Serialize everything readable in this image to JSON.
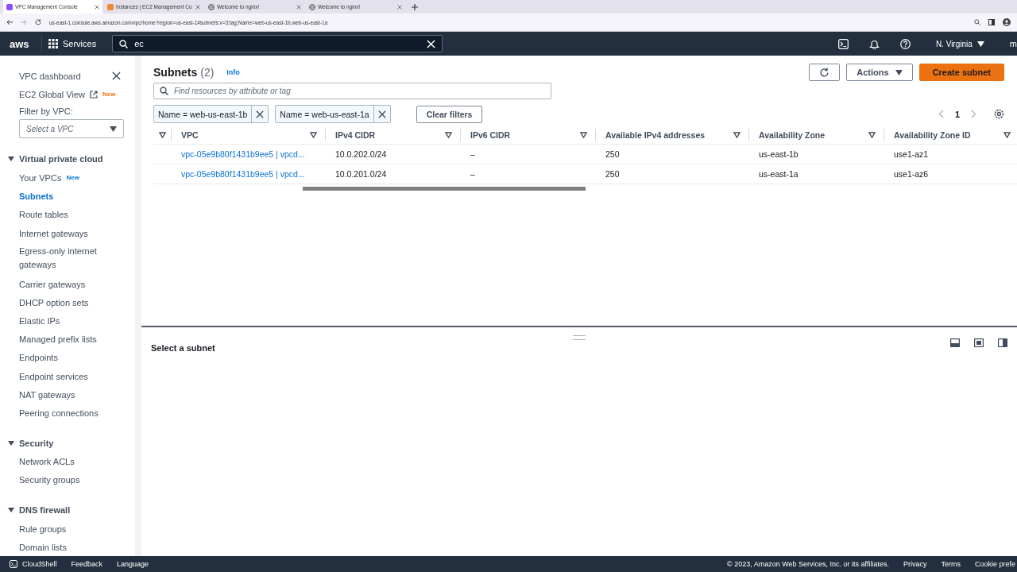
{
  "browser": {
    "tabs": [
      {
        "title": "VPC Management Console",
        "selected": true,
        "kind": "vpc"
      },
      {
        "title": "Instances | EC2 Management Co",
        "selected": false,
        "kind": "ec2"
      },
      {
        "title": "Welcome to nginx!",
        "selected": false,
        "kind": "globe"
      },
      {
        "title": "Welcome to nginx!",
        "selected": false,
        "kind": "globe"
      }
    ],
    "url": "us-east-1.console.aws.amazon.com/vpc/home?region=us-east-1#subnets:v=3;tag:Name=web-us-east-1b,web-us-east-1a"
  },
  "topnav": {
    "logo": "aws",
    "services": "Services",
    "search": "ec",
    "region": "N. Virginia",
    "account": "m"
  },
  "sidebar": {
    "top_items": [
      {
        "label": "VPC dashboard"
      },
      {
        "label": "EC2 Global View",
        "external": true,
        "badge": "New"
      }
    ],
    "filter_label": "Filter by VPC:",
    "filter_placeholder": "Select a VPC",
    "sections": [
      {
        "title": "Virtual private cloud",
        "expanded": true,
        "items": [
          {
            "label": "Your VPCs",
            "badge": "New",
            "selected": false
          },
          {
            "label": "Subnets",
            "selected": true
          },
          {
            "label": "Route tables",
            "selected": false
          },
          {
            "label": "Internet gateways",
            "selected": false
          },
          {
            "label": "Egress-only internet gateways",
            "selected": false
          },
          {
            "label": "Carrier gateways",
            "selected": false
          },
          {
            "label": "DHCP option sets",
            "selected": false
          },
          {
            "label": "Elastic IPs",
            "selected": false
          },
          {
            "label": "Managed prefix lists",
            "selected": false
          },
          {
            "label": "Endpoints",
            "selected": false
          },
          {
            "label": "Endpoint services",
            "selected": false
          },
          {
            "label": "NAT gateways",
            "selected": false
          },
          {
            "label": "Peering connections",
            "selected": false
          }
        ]
      },
      {
        "title": "Security",
        "expanded": true,
        "items": [
          {
            "label": "Network ACLs",
            "selected": false
          },
          {
            "label": "Security groups",
            "selected": false
          }
        ]
      },
      {
        "title": "DNS firewall",
        "expanded": true,
        "items": [
          {
            "label": "Rule groups",
            "selected": false
          },
          {
            "label": "Domain lists",
            "selected": false
          }
        ]
      }
    ]
  },
  "header": {
    "title": "Subnets",
    "count": "(2)",
    "info": "Info",
    "actions": "Actions",
    "create": "Create subnet"
  },
  "search": {
    "placeholder": "Find resources by attribute or tag"
  },
  "filters": [
    "Name = web-us-east-1b",
    "Name = web-us-east-1a"
  ],
  "clear_filters": "Clear filters",
  "pagination": {
    "page": "1"
  },
  "table": {
    "columns": [
      "VPC",
      "IPv4 CIDR",
      "IPv6 CIDR",
      "Available IPv4 addresses",
      "Availability Zone",
      "Availability Zone ID"
    ],
    "rows": [
      [
        "vpc-05e9b80f1431b9ee5 | vpcd...",
        "10.0.202.0/24",
        "–",
        "250",
        "us-east-1b",
        "use1-az1"
      ],
      [
        "vpc-05e9b80f1431b9ee5 | vpcd...",
        "10.0.201.0/24",
        "–",
        "250",
        "us-east-1a",
        "use1-az6"
      ]
    ]
  },
  "split_panel": {
    "title": "Select a subnet"
  },
  "footer": {
    "cloudshell": "CloudShell",
    "feedback": "Feedback",
    "language": "Language",
    "copyright": "© 2023, Amazon Web Services, Inc. or its affiliates.",
    "links": [
      "Privacy",
      "Terms",
      "Cookie prefe"
    ]
  }
}
